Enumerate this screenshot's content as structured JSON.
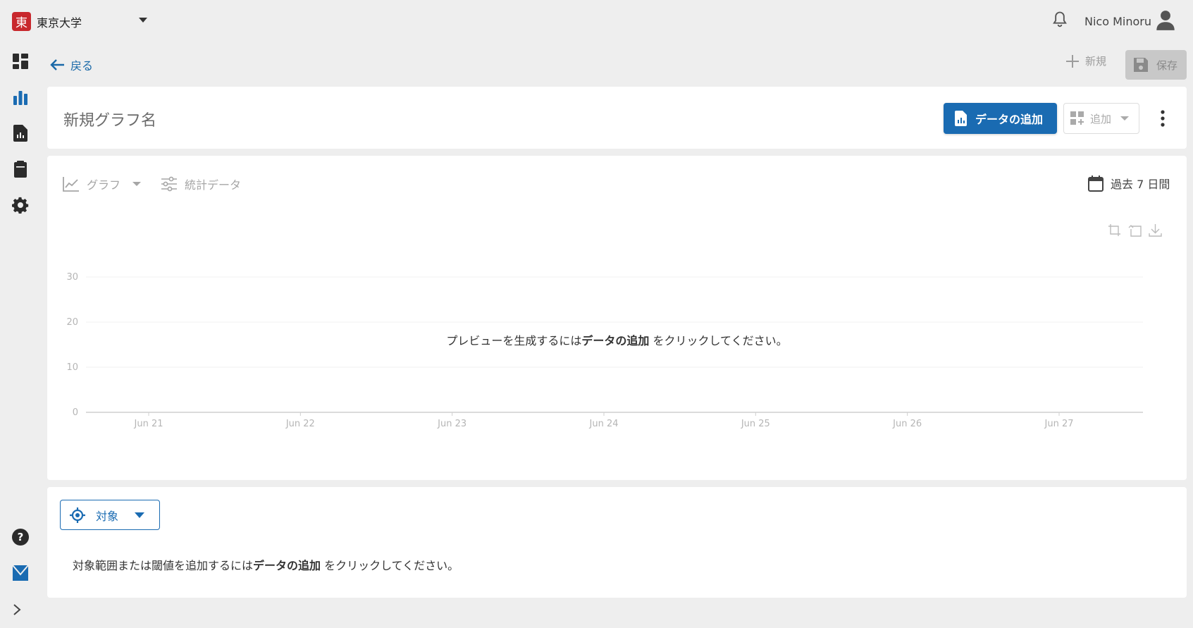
{
  "header": {
    "org_logo_char": "東",
    "org_name": "東京大学",
    "user_name": "Nico Minoru"
  },
  "sidebar": {
    "items": [
      "dashboard-icon",
      "bar-chart-icon",
      "report-icon",
      "clipboard-icon",
      "gear-icon"
    ],
    "bottom_items": [
      "help-icon",
      "bookmark-icon",
      "expand-icon"
    ]
  },
  "toolbar": {
    "back_label": "戻る",
    "new_label": "新規",
    "save_label": "保存"
  },
  "title_card": {
    "graph_name": "新規グラフ名",
    "add_data_label": "データの追加",
    "add_label": "追加"
  },
  "chart_card": {
    "graph_type_label": "グラフ",
    "stats_label": "統計データ",
    "date_range_label": "過去 7 日間",
    "message_prefix": "プレビューを生成するには",
    "message_bold": "データの追加",
    "message_suffix": " をクリックしてください。"
  },
  "chart_data": {
    "type": "line",
    "categories": [
      "Jun 21",
      "Jun 22",
      "Jun 23",
      "Jun 24",
      "Jun 25",
      "Jun 26",
      "Jun 27"
    ],
    "y_ticks": [
      "0",
      "10",
      "20",
      "30"
    ],
    "ylim": [
      0,
      30
    ],
    "series": [],
    "grid": true
  },
  "target_card": {
    "target_label": "対象",
    "message_prefix": "対象範囲または閾値を追加するには",
    "message_bold": "データの追加",
    "message_suffix": " をクリックしてください。"
  },
  "colors": {
    "accent": "#1a6bb2",
    "brand_red": "#c8282d",
    "background": "#eeeeee"
  }
}
